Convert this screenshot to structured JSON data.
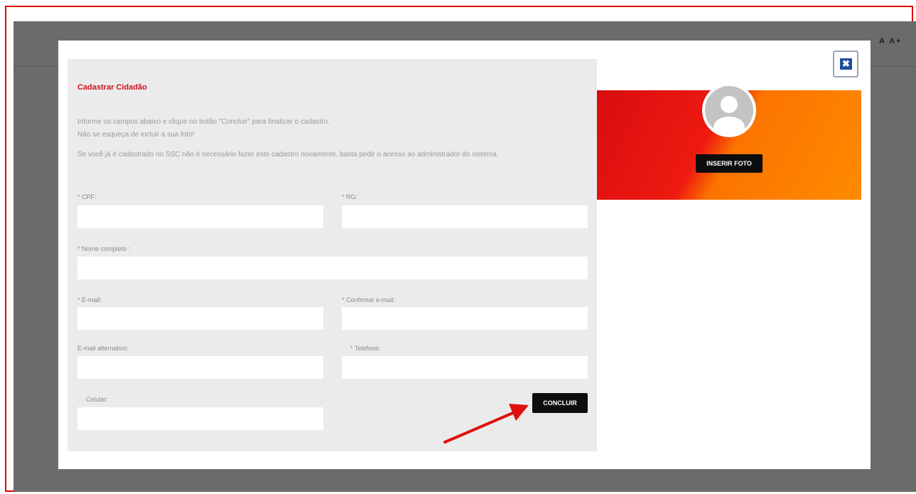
{
  "header": {
    "font_controls": "A  A+"
  },
  "modal": {
    "title": "Cadastrar Cidadão",
    "info_line1": "Informe os campos abaixo e clique no botão \"Concluir\" para finalizar o cadastro.",
    "info_line2": "Não se esqueça de incluir a sua foto!",
    "info_line3": "Se você já é cadastrado no SSC não é necessário fazer este cadastro novamente, basta pedir o acesso ao administrador do sistema.",
    "close_icon": "close-icon",
    "fields": {
      "cpf": {
        "label": "* CPF:",
        "value": ""
      },
      "rg": {
        "label": "* RG:",
        "value": ""
      },
      "nome": {
        "label": "* Nome completo :",
        "value": ""
      },
      "email": {
        "label": "* E-mail:",
        "value": ""
      },
      "confirm_email": {
        "label": "* Confirmar e-mail:",
        "value": ""
      },
      "email_alt": {
        "label": "E-mail alternativo:",
        "value": ""
      },
      "telefone": {
        "label": "* Telefone:",
        "value": ""
      },
      "celular": {
        "label": "Celular:",
        "value": ""
      }
    },
    "submit_label": "CONCLUIR",
    "photo": {
      "button_label": "INSERIR FOTO",
      "avatar_icon": "user-avatar-icon"
    }
  },
  "colors": {
    "title_red": "#d0101a",
    "banner_red": "#e0121a",
    "banner_orange": "#ff8a00",
    "arrow_red": "#e01010",
    "close_blue": "#1f4ea1"
  }
}
